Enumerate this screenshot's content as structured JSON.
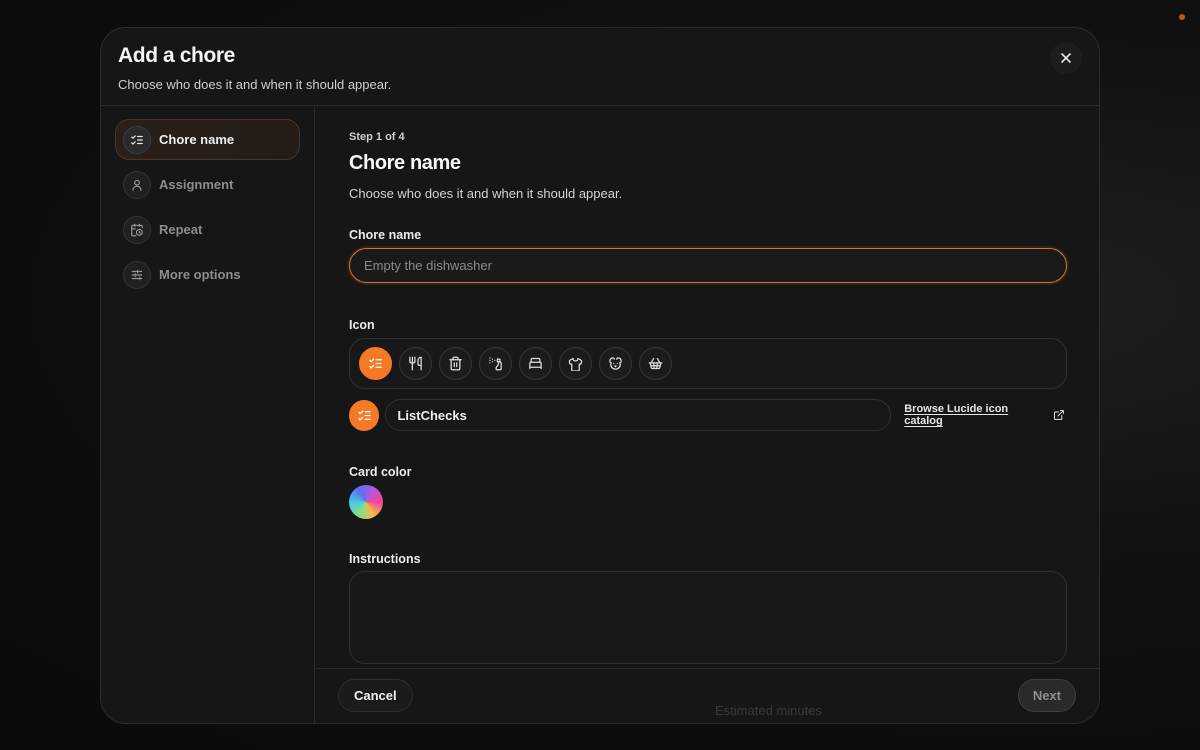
{
  "modal": {
    "title": "Add a chore",
    "subtitle": "Choose who does it and when it should appear."
  },
  "sidebar": {
    "steps": [
      {
        "label": "Chore name",
        "icon": "list-checks-icon",
        "active": true
      },
      {
        "label": "Assignment",
        "icon": "user-icon",
        "active": false
      },
      {
        "label": "Repeat",
        "icon": "calendar-clock-icon",
        "active": false
      },
      {
        "label": "More options",
        "icon": "sliders-icon",
        "active": false
      }
    ]
  },
  "main": {
    "step_count": "Step 1 of 4",
    "title": "Chore name",
    "subtitle": "Choose who does it and when it should appear.",
    "chore_name": {
      "label": "Chore name",
      "placeholder": "Empty the dishwasher",
      "value": ""
    },
    "icon": {
      "label": "Icon",
      "options": [
        "list-checks-icon",
        "utensils-icon",
        "trash-icon",
        "spray-bottle-icon",
        "bed-icon",
        "shirt-icon",
        "dog-icon",
        "basket-icon"
      ],
      "selected": "list-checks-icon",
      "selected_name": "ListChecks",
      "browse_label": "Browse Lucide icon catalog"
    },
    "card_color": {
      "label": "Card color"
    },
    "instructions": {
      "label": "Instructions",
      "value": ""
    }
  },
  "footer": {
    "cancel_label": "Cancel",
    "next_label": "Next",
    "ghost_label": "Estimated minutes"
  },
  "colors": {
    "accent": "#f47a25",
    "background": "#161617",
    "border": "#2f2f32"
  }
}
